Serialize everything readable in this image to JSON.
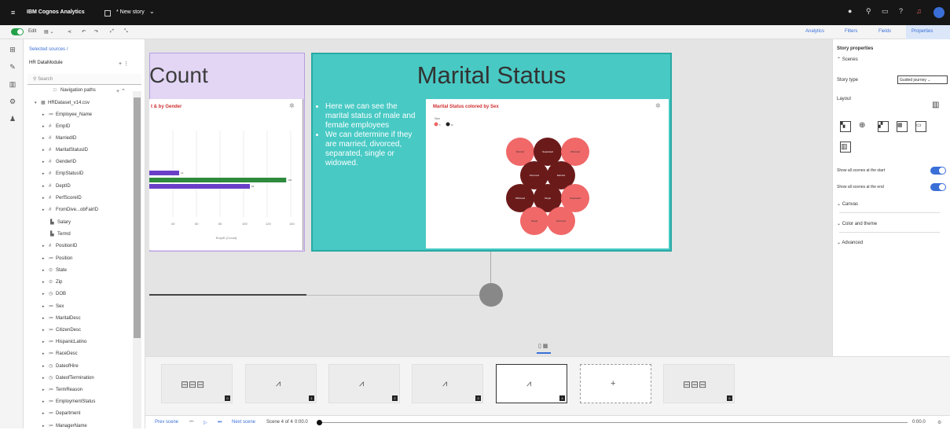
{
  "app": {
    "brand": "IBM Cognos Analytics",
    "story_title": "* New story"
  },
  "toolbar": {
    "edit_label": "Edit",
    "analytics": "Analytics",
    "filters": "Filters",
    "fields": "Fields",
    "properties": "Properties"
  },
  "datapanel": {
    "selected_sources": "Selected sources /",
    "module": "HR DataModule",
    "search_placeholder": "Search",
    "items": [
      {
        "label": "Navigation paths",
        "icon": "□",
        "arrow": ""
      },
      {
        "label": "HRDataset_v14.csv",
        "icon": "▦",
        "arrow": "▾"
      },
      {
        "label": "Employee_Name",
        "icon": "≔",
        "arrow": "▸"
      },
      {
        "label": "EmpID",
        "icon": "#",
        "arrow": "▸"
      },
      {
        "label": "MarriedID",
        "icon": "#",
        "arrow": "▸"
      },
      {
        "label": "MaritalStatusID",
        "icon": "#",
        "arrow": "▸"
      },
      {
        "label": "GenderID",
        "icon": "#",
        "arrow": "▸"
      },
      {
        "label": "EmpStatusID",
        "icon": "#",
        "arrow": "▸"
      },
      {
        "label": "DeptID",
        "icon": "#",
        "arrow": "▸"
      },
      {
        "label": "PerfScoreID",
        "icon": "#",
        "arrow": "▸"
      },
      {
        "label": "FromDive...obFairID",
        "icon": "#",
        "arrow": "▸"
      },
      {
        "label": "Salary",
        "icon": "▙",
        "arrow": ""
      },
      {
        "label": "Termd",
        "icon": "▙",
        "arrow": ""
      },
      {
        "label": "PositionID",
        "icon": "#",
        "arrow": "▸"
      },
      {
        "label": "Position",
        "icon": "≔",
        "arrow": "▸"
      },
      {
        "label": "State",
        "icon": "⊙",
        "arrow": "▸"
      },
      {
        "label": "Zip",
        "icon": "⊙",
        "arrow": "▸"
      },
      {
        "label": "DOB",
        "icon": "◷",
        "arrow": "▸"
      },
      {
        "label": "Sex",
        "icon": "≔",
        "arrow": "▸"
      },
      {
        "label": "MaritalDesc",
        "icon": "≔",
        "arrow": "▸"
      },
      {
        "label": "CitizenDesc",
        "icon": "≔",
        "arrow": "▸"
      },
      {
        "label": "HispanicLatino",
        "icon": "≔",
        "arrow": "▸"
      },
      {
        "label": "RaceDesc",
        "icon": "≔",
        "arrow": "▸"
      },
      {
        "label": "DateofHire",
        "icon": "◷",
        "arrow": "▸"
      },
      {
        "label": "DateofTermination",
        "icon": "◷",
        "arrow": "▸"
      },
      {
        "label": "TermReason",
        "icon": "≔",
        "arrow": "▸"
      },
      {
        "label": "EmploymentStatus",
        "icon": "≔",
        "arrow": "▸"
      },
      {
        "label": "Department",
        "icon": "≔",
        "arrow": "▸"
      },
      {
        "label": "ManagerName",
        "icon": "≔",
        "arrow": "▸"
      }
    ]
  },
  "canvas": {
    "count_title": "Count",
    "count_chart_title": "t & by Gender",
    "count_chart_xlabel": "EmpID (Count)",
    "marital_title": "Marital Status",
    "bullets": [
      "Here we can see the marital status of male and female employees",
      "We can determine if they are married, divorced, separated, single or widowed."
    ],
    "bubble_title": "Marital Status colored by Sex",
    "bubble_legend_title": "Sex",
    "bubble_legend": [
      "F",
      "M"
    ]
  },
  "chart_data": [
    {
      "type": "bar",
      "title": "t & by Gender",
      "xlabel": "EmpID (Count)",
      "xlim": [
        0,
        140
      ],
      "xticks": [
        "40",
        "60",
        "80",
        "100",
        "120",
        "140"
      ],
      "series": [
        {
          "values": [
            14,
            120,
            84
          ]
        }
      ],
      "value_labels": [
        "14",
        "120",
        "84"
      ],
      "colors": [
        "#6a3fc8",
        "#2e8b3e",
        "#6a3fc8"
      ]
    },
    {
      "type": "scatter",
      "title": "Marital Status colored by Sex",
      "bubbles": [
        {
          "label": "Married",
          "sex": "F"
        },
        {
          "label": "Separated",
          "sex": "M"
        },
        {
          "label": "Widowed",
          "sex": "F"
        },
        {
          "label": "Divorced",
          "sex": "M"
        },
        {
          "label": "Married",
          "sex": "M"
        },
        {
          "label": "Widowed",
          "sex": "M"
        },
        {
          "label": "Single",
          "sex": "M"
        },
        {
          "label": "Separated",
          "sex": "F"
        },
        {
          "label": "Single",
          "sex": "F"
        },
        {
          "label": "Divorced",
          "sex": "F"
        }
      ],
      "colors": {
        "F": "#f06868",
        "M": "#6b1a1a"
      }
    }
  ],
  "filmstrip": {
    "scenes": [
      {
        "num": "0",
        "icon": "diagram"
      },
      {
        "num": "1",
        "icon": "line"
      },
      {
        "num": "2",
        "icon": "line"
      },
      {
        "num": "3",
        "icon": "line"
      },
      {
        "num": "4",
        "icon": "line"
      },
      {
        "num": "",
        "icon": "add"
      },
      {
        "num": "6",
        "icon": "diagram"
      }
    ]
  },
  "bottombar": {
    "prev": "Prev scene",
    "next": "Next scene",
    "scene_info": "Scene 4 of 4",
    "time": "0:00.0",
    "end_time": "0:00.0"
  },
  "props": {
    "header": "Story properties",
    "scenes": "Scenes",
    "story_type_label": "Story type",
    "story_type_value": "Guided journey",
    "layout_label": "Layout",
    "show_start": "Show all scenes at the start",
    "show_end": "Show all scenes at the end",
    "canvas": "Canvas",
    "color_theme": "Color and theme",
    "advanced": "Advanced"
  }
}
